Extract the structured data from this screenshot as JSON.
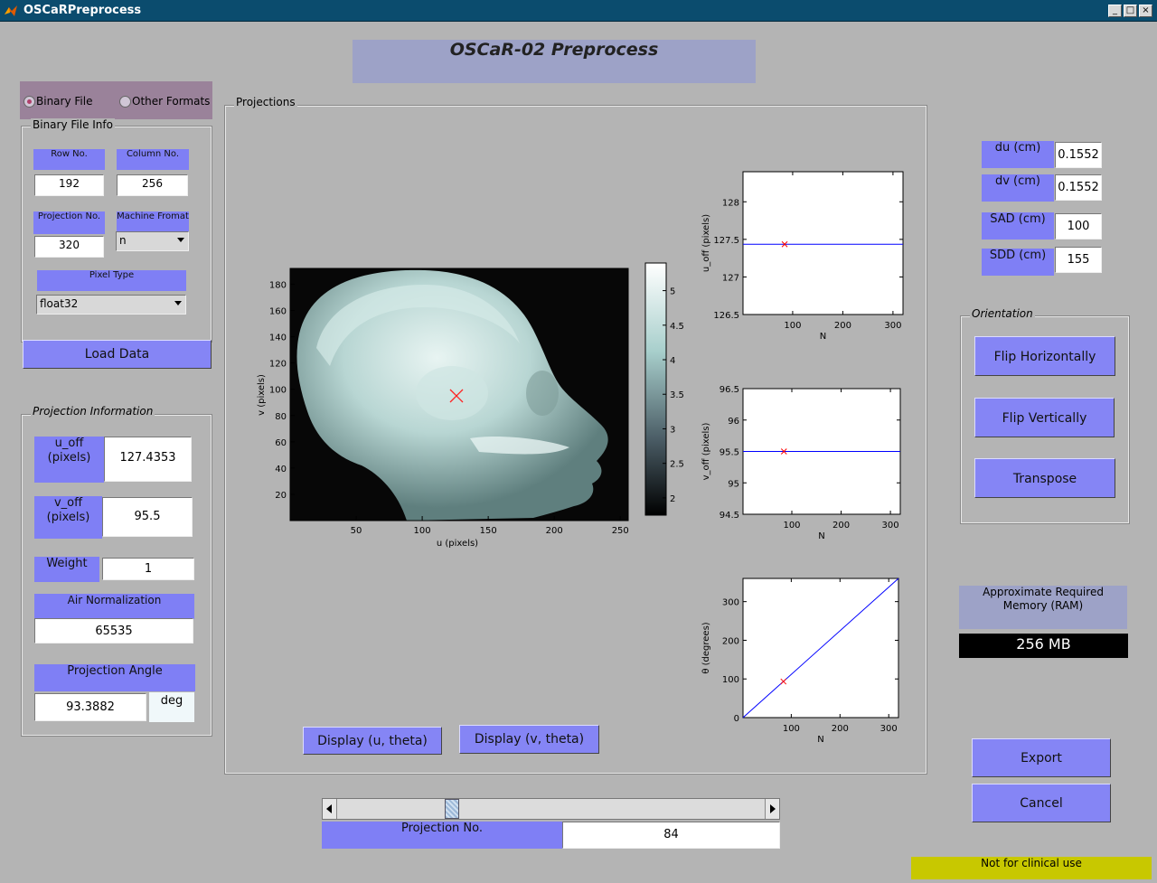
{
  "window": {
    "title": "OSCaRPreprocess",
    "controls": [
      "_",
      "□",
      "×"
    ]
  },
  "header": {
    "title": "OSCaR-02 Preprocess"
  },
  "file_type": {
    "options": [
      {
        "label": "Binary File",
        "selected": true
      },
      {
        "label": "Other Formats",
        "selected": false
      }
    ]
  },
  "binary_info": {
    "panel_label": "Binary File Info",
    "row_label": "Row No.",
    "row_value": "192",
    "col_label": "Column No.",
    "col_value": "256",
    "proj_label": "Projection No.",
    "proj_value": "320",
    "machine_label": "Machine Fromat",
    "machine_value": "n",
    "pixel_type_label": "Pixel Type",
    "pixel_type_value": "float32"
  },
  "load_button": "Load Data",
  "projection_info": {
    "panel_label": "Projection Information",
    "u_off_label": "u_off\n(pixels)",
    "u_off_value": "127.4353",
    "v_off_label": "v_off\n(pixels)",
    "v_off_value": "95.5",
    "weight_label": "Weight",
    "weight_value": "1",
    "air_label": "Air Normalization",
    "air_value": "65535",
    "angle_label": "Projection Angle",
    "angle_value": "93.3882",
    "angle_unit": "deg"
  },
  "projections": {
    "panel_label": "Projections",
    "display_u_button": "Display (u, theta)",
    "display_v_button": "Display (v, theta)"
  },
  "image_axes": {
    "xlabel": "u (pixels)",
    "ylabel": "v (pixels)",
    "xticks": [
      "50",
      "100",
      "150",
      "200",
      "250"
    ],
    "yticks": [
      "20",
      "40",
      "60",
      "80",
      "100",
      "120",
      "140",
      "160",
      "180"
    ],
    "colorbar_ticks": [
      "5",
      "4.5",
      "4",
      "3.5",
      "3",
      "2.5",
      "2"
    ],
    "marker": {
      "u": 127.4,
      "v": 95.5
    }
  },
  "chart_data": [
    {
      "type": "line",
      "ylabel": "u_off (pixels)",
      "xlabel": "N",
      "x": [
        1,
        320
      ],
      "ylim": [
        126.5,
        128.4
      ],
      "xlim": [
        1,
        320
      ],
      "yticks": [
        126.5,
        127,
        127.5,
        128
      ],
      "xticks": [
        100,
        200,
        300
      ],
      "series": [
        {
          "values": [
            127.4353,
            127.4353
          ],
          "color": "#0000ff"
        }
      ],
      "marker": {
        "x": 84,
        "y": 127.4353,
        "color": "#ff0000"
      }
    },
    {
      "type": "line",
      "ylabel": "v_off (pixels)",
      "xlabel": "N",
      "x": [
        1,
        320
      ],
      "ylim": [
        94.5,
        96.5
      ],
      "xlim": [
        1,
        320
      ],
      "yticks": [
        94.5,
        95,
        95.5,
        96,
        96.5
      ],
      "xticks": [
        100,
        200,
        300
      ],
      "series": [
        {
          "values": [
            95.5,
            95.5
          ],
          "color": "#0000ff"
        }
      ],
      "marker": {
        "x": 84,
        "y": 95.5,
        "color": "#ff0000"
      }
    },
    {
      "type": "line",
      "ylabel": "θ (degrees)",
      "xlabel": "N",
      "x": [
        1,
        320
      ],
      "ylim": [
        0,
        360
      ],
      "xlim": [
        1,
        320
      ],
      "yticks": [
        0,
        100,
        200,
        300
      ],
      "xticks": [
        100,
        200,
        300
      ],
      "series": [
        {
          "values": [
            0,
            360
          ],
          "color": "#0000ff"
        }
      ],
      "marker": {
        "x": 84,
        "y": 93.3882,
        "color": "#ff0000"
      }
    }
  ],
  "geometry": {
    "du_label": "du (cm)",
    "du_value": "0.1552",
    "dv_label": "dv (cm)",
    "dv_value": "0.1552",
    "sad_label": "SAD (cm)",
    "sad_value": "100",
    "sdd_label": "SDD (cm)",
    "sdd_value": "155"
  },
  "orientation": {
    "panel_label": "Orientation",
    "flip_h": "Flip Horizontally",
    "flip_v": "Flip Vertically",
    "transpose": "Transpose"
  },
  "memory": {
    "label": "Approximate Required Memory  (RAM)",
    "value": "256 MB"
  },
  "slider": {
    "value": 84,
    "min": 1,
    "max": 320
  },
  "projection_no": {
    "label": "Projection No.",
    "value": "84"
  },
  "export_button": "Export",
  "cancel_button": "Cancel",
  "disclaimer": "Not for clinical use",
  "colors": {
    "accent": "#7f7ff5",
    "background": "#b4b4b4",
    "titlebar": "#0b4c6e",
    "warning": "#c8c800"
  }
}
